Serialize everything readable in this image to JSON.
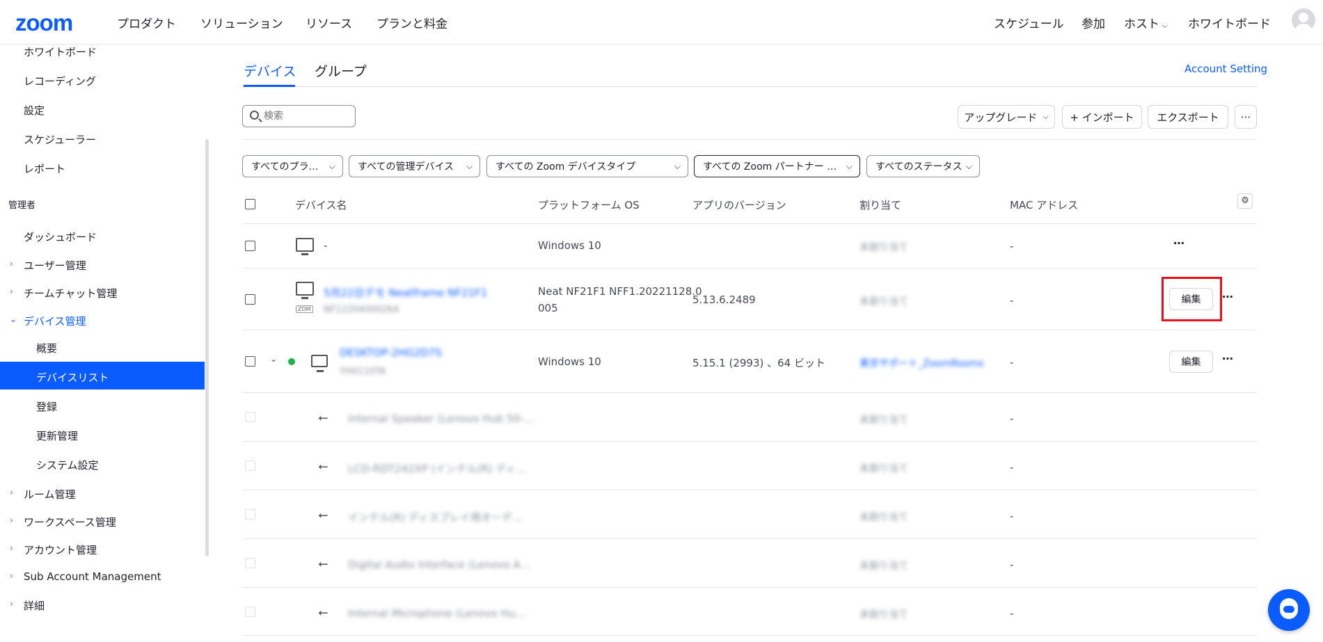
{
  "header": {
    "logo": "zoom",
    "nav": [
      "プロダクト",
      "ソリューション",
      "リソース",
      "プランと料金"
    ],
    "right": {
      "schedule": "スケジュール",
      "join": "参加",
      "host": "ホスト",
      "whiteboard": "ホワイトボード"
    }
  },
  "sidebar": {
    "top_items": [
      "ホワイトボード",
      "レコーディング",
      "設定",
      "スケジューラー",
      "レポート"
    ],
    "admin_section": "管理者",
    "dashboard": "ダッシュボード",
    "user_mgmt": "ユーザー管理",
    "team_chat_mgmt": "チームチャット管理",
    "device_mgmt": "デバイス管理",
    "device_sub": [
      "概要",
      "デバイスリスト",
      "登録",
      "更新管理",
      "システム設定"
    ],
    "room_mgmt": "ルーム管理",
    "workspace_mgmt": "ワークスペース管理",
    "account_mgmt": "アカウント管理",
    "sub_account": "Sub Account Management",
    "details": "詳細"
  },
  "tabs": {
    "devices": "デバイス",
    "groups": "グループ"
  },
  "account_setting": "Account Setting",
  "search": {
    "placeholder": "検索"
  },
  "toolbar": {
    "upgrade": "アップグレード",
    "import": "+ インポート",
    "export": "エクスポート"
  },
  "filters": [
    "すべてのプラ…",
    "すべての管理デバイス",
    "すべての Zoom デバイスタイプ",
    "すべての Zoom パートナー …",
    "すべてのステータス"
  ],
  "columns": {
    "name": "デバイス名",
    "os": "プラットフォーム OS",
    "version": "アプリのバージョン",
    "assign": "割り当て",
    "mac": "MAC アドレス"
  },
  "rows": [
    {
      "name": "-",
      "os": "Windows 10",
      "version": "",
      "assign": "未割り当て",
      "mac": "-"
    },
    {
      "name": "5月22日デモ Neatframe NF21F1",
      "serial": "NF12204000264",
      "badge": "ZDM",
      "os_line1": "Neat NF21F1 NFF1.20221128.0",
      "os_line2": "005",
      "version": "5.13.6.2489",
      "assign": "未割り当て",
      "mac": "-",
      "edit": "編集"
    },
    {
      "name": "DESKTOP-2HG2D7S",
      "serial": "YH0110TA",
      "os": "Windows 10",
      "version": "5.15.1 (2993) 、64 ビット",
      "assign": "東京サポート_ZoomRooms",
      "mac": "-",
      "edit": "編集"
    }
  ],
  "sub_rows": [
    {
      "name": "Internal Speaker (Lenovo Hub 50-…",
      "assign": "未割り当て",
      "mac": "-"
    },
    {
      "name": "LCD-RDT242XP (インテル(R) ディ…",
      "assign": "未割り当て",
      "mac": "-"
    },
    {
      "name": "インテル(R) ディスプレイ用オーデ…",
      "assign": "未割り当て",
      "mac": "-"
    },
    {
      "name": "Digital Audio Interface (Lenovo A…",
      "assign": "未割り当て",
      "mac": "-"
    },
    {
      "name": "Internal Microphone (Lenovo Hu…",
      "assign": "未割り当て",
      "mac": "-"
    }
  ],
  "colors": {
    "brand": "#0b5cff",
    "highlight": "#e8101a",
    "online": "#1cb34a"
  }
}
